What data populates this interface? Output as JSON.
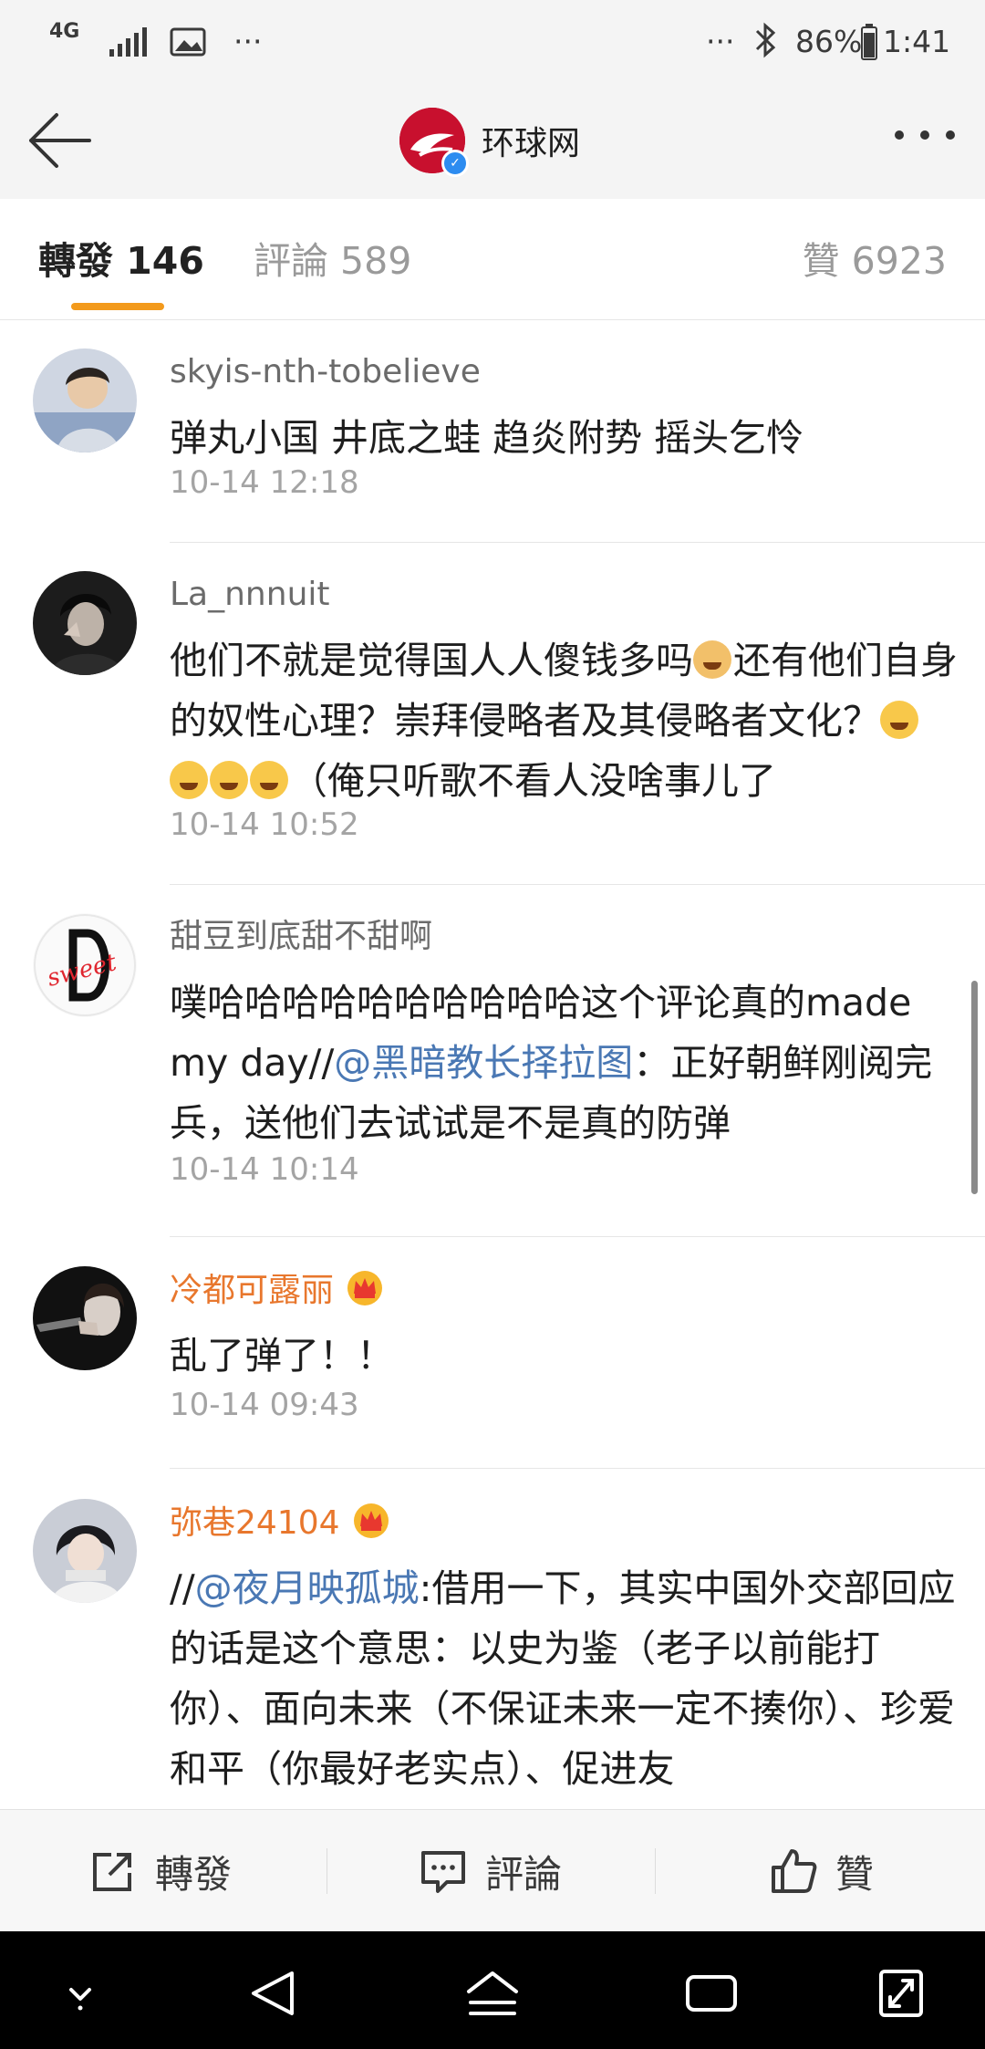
{
  "status_bar": {
    "network": "4G",
    "more": "···",
    "right_more": "···",
    "battery": "86%",
    "time": "1:41"
  },
  "header": {
    "title": "环球网"
  },
  "tabs": {
    "repost": "轉發 146",
    "comment": "評論 589",
    "like": "贊 6923"
  },
  "comments": [
    {
      "user": "skyis-nth-tobelieve",
      "vip": false,
      "text": "弹丸小国 井底之蛙 趋炎附势 摇头乞怜",
      "time": "10-14 12:18"
    },
    {
      "user": "La_nnnuit",
      "vip": false,
      "text_1": "他们不就是觉得国人人傻钱多吗",
      "text_2": "还有他们自身的奴性心理？崇拜侵略者及其侵略者文化？",
      "text_3": "（俺只听歌不看人没啥事儿了",
      "time": "10-14 10:52"
    },
    {
      "user": "甜豆到底甜不甜啊",
      "vip": false,
      "text_1": "噗哈哈哈哈哈哈哈哈哈哈这个评论真的made my day//",
      "mention": "@黑暗教长择拉图",
      "text_2": "：正好朝鲜刚阅完兵，送他们去试试是不是真的防弹",
      "time": "10-14 10:14"
    },
    {
      "user": "冷都可露丽",
      "vip": true,
      "text": "乱了弹了！！",
      "time": "10-14 09:43"
    },
    {
      "user": "弥巷24104",
      "vip": true,
      "text_1": "//",
      "mention": "@夜月映孤城",
      "text_2": ":借用一下，其实中国外交部回应的话是这个意思：以史为鉴（老子以前能打你）、面向未来（不保证未来一定不揍你）、珍爱和平（你最好老实点）、促进友"
    }
  ],
  "action_bar": {
    "repost": "轉發",
    "comment": "評論",
    "like": "贊"
  },
  "colors": {
    "accent_underline": "#f39a1c",
    "vip_name": "#e8772d",
    "mention": "#4a78b4",
    "brand": "#c8102e"
  }
}
